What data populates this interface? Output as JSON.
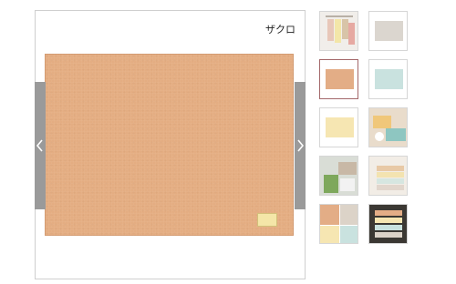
{
  "viewer": {
    "caption": "ザクロ",
    "product_color": "#e4ad82",
    "tag_text": "",
    "prev_icon": "chevron-left-icon",
    "next_icon": "chevron-right-icon"
  },
  "thumbnails": [
    {
      "name": "towels-hanging",
      "active": false
    },
    {
      "name": "beige-mat",
      "active": false
    },
    {
      "name": "pomegranate-mat",
      "active": true
    },
    {
      "name": "mint-mat",
      "active": false
    },
    {
      "name": "yellow-mat",
      "active": false
    },
    {
      "name": "table-setting",
      "active": false
    },
    {
      "name": "bathroom-scene",
      "active": false
    },
    {
      "name": "folded-towels",
      "active": false
    },
    {
      "name": "collage-set",
      "active": false
    },
    {
      "name": "color-stack",
      "active": false
    }
  ],
  "colors": {
    "accent_active_border": "#a3686a",
    "nav_bar": "#9a9a9a"
  }
}
